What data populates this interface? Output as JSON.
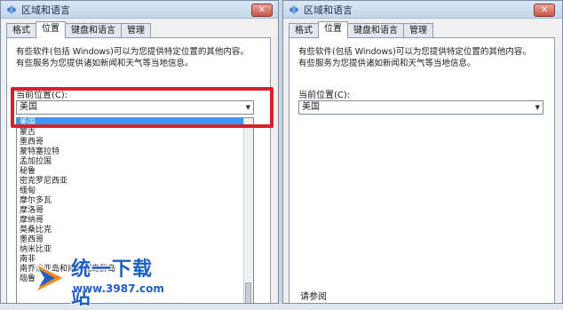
{
  "left_window": {
    "title": "区域和语言",
    "close_glyph": "✕",
    "tabs": [
      "格式",
      "位置",
      "键盘和语言",
      "管理"
    ],
    "active_tab": "位置",
    "description": "有些软件(包括 Windows)可以为您提供特定位置的其他内容。有些服务为您提供诸如新闻和天气等当地信息。",
    "location_label": "当前位置(C):",
    "location_value": "美国",
    "dropdown_arrow": "▼",
    "options": [
      "美国",
      "蒙古",
      "墨西哥",
      "蒙特塞拉特",
      "孟加拉国",
      "秘鲁",
      "密克罗尼西亚",
      "缅甸",
      "摩尔多瓦",
      "摩洛哥",
      "摩纳哥",
      "莫桑比克",
      "墨西哥",
      "纳米比亚",
      "南非",
      "南乔治亚岛和南桑威奇群岛",
      "瑙鲁"
    ],
    "selected_option": "美国"
  },
  "right_window": {
    "title": "区域和语言",
    "close_glyph": "✕",
    "tabs": [
      "格式",
      "位置",
      "键盘和语言",
      "管理"
    ],
    "active_tab": "位置",
    "description": "有些软件(包括 Windows)可以为您提供特定位置的其他内容。有些服务为您提供诸如新闻和天气等当地信息。",
    "location_label": "当前位置(C):",
    "location_value": "美国",
    "dropdown_arrow": "▼",
    "see_also": "请参阅"
  },
  "watermark": {
    "title": "统一下载站",
    "url": "www.3987.com"
  },
  "colors": {
    "highlight_border": "#d8202a",
    "selection": "#3399ff",
    "watermark": "#1f5fc4"
  }
}
